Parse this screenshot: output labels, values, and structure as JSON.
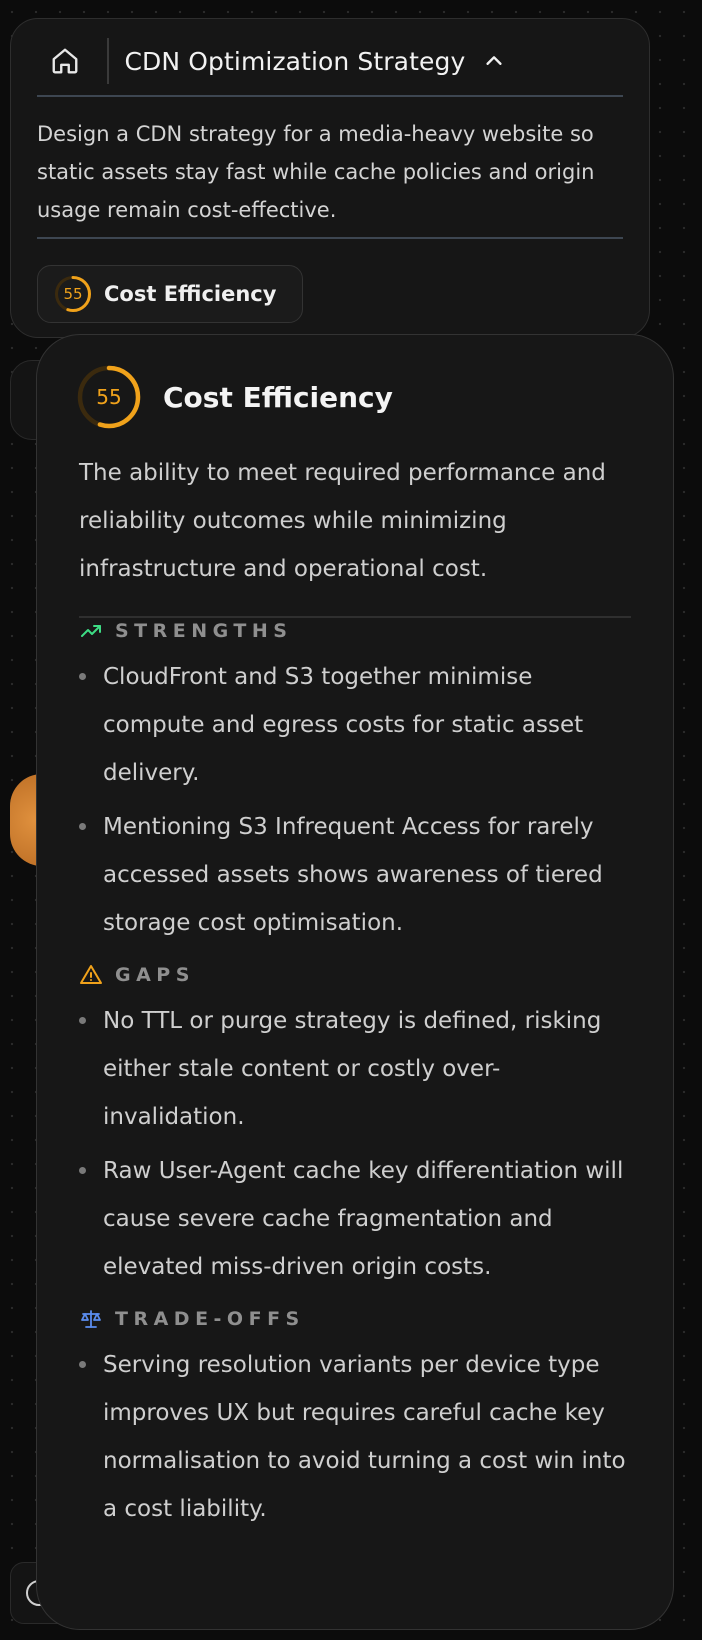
{
  "header": {
    "title": "CDN Optimization Strategy",
    "description": "Design a CDN strategy for a media-heavy website so static assets stay fast while cache policies and origin usage remain cost-effective.",
    "badge": {
      "score": "55",
      "label": "Cost Efficiency",
      "score_fraction": 0.55
    }
  },
  "popover": {
    "score": "55",
    "score_fraction": 0.55,
    "title": "Cost Efficiency",
    "description": "The ability to meet required performance and reliability outcomes while minimizing infrastructure and operational cost.",
    "sections": {
      "strengths": {
        "label": "STRENGTHS",
        "icon": "trending-up-icon",
        "color": "#3ddc84",
        "items": [
          "CloudFront and S3 together minimise compute and egress costs for static asset delivery.",
          "Mentioning S3 Infrequent Access for rarely accessed assets shows awareness of tiered storage cost optimisation."
        ]
      },
      "gaps": {
        "label": "GAPS",
        "icon": "warning-icon",
        "color": "#f0a21b",
        "items": [
          "No TTL or purge strategy is defined, risking either stale content or costly over-invalidation.",
          "Raw User-Agent cache key differentiation will cause severe cache fragmentation and elevated miss-driven origin costs."
        ]
      },
      "tradeoffs": {
        "label": "TRADE-OFFS",
        "icon": "scale-icon",
        "color": "#5b8def",
        "items": [
          "Serving resolution variants per device type improves UX but requires careful cache key normalisation to avoid turning a cost win into a cost liability."
        ]
      }
    }
  },
  "colors": {
    "accent": "#f0a21b",
    "background": "#0c0c0c",
    "card": "#161616"
  }
}
